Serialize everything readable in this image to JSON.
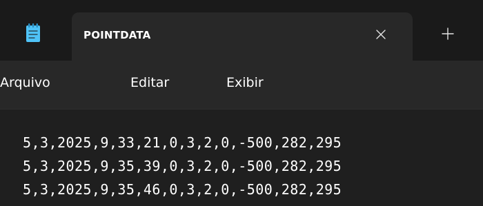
{
  "window": {
    "app_icon": "notepad-icon",
    "tab": {
      "title": "POINTDATA",
      "close_icon": "close-icon"
    },
    "new_tab_icon": "plus-icon"
  },
  "menu": {
    "items": [
      {
        "label": "Arquivo"
      },
      {
        "label": "Editar"
      },
      {
        "label": "Exibir"
      }
    ]
  },
  "editor": {
    "lines": [
      "5,3,2025,9,33,21,0,3,2,0,-500,282,295",
      "5,3,2025,9,35,39,0,3,2,0,-500,282,295",
      "5,3,2025,9,35,46,0,3,2,0,-500,282,295"
    ]
  },
  "colors": {
    "titlebar_bg": "#1a1a1a",
    "tab_bg": "#282828",
    "menubar_bg": "#282828",
    "editor_bg": "#1f1f1f",
    "text": "#ffffff",
    "icon_accent": "#4fc3f7"
  }
}
